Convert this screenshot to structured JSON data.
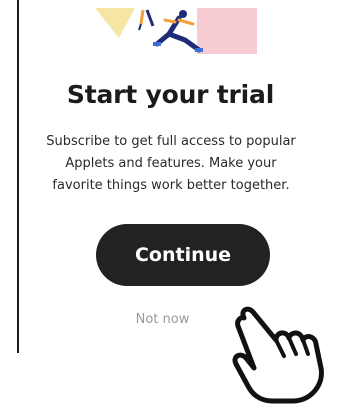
{
  "screen": {
    "title": "Start your trial",
    "description": "Subscribe to get full access to popular Applets and features. Make your favorite things work better together.",
    "continue_label": "Continue",
    "not_now_label": "Not now"
  },
  "illustration": {
    "icon": "running-people-illustration",
    "colors": {
      "yellow": "#f6e6a6",
      "pink": "#f7cdd3",
      "blue": "#1f2c78",
      "orange": "#f4a03a"
    }
  },
  "overlay": {
    "icon": "pointing-hand-icon"
  }
}
